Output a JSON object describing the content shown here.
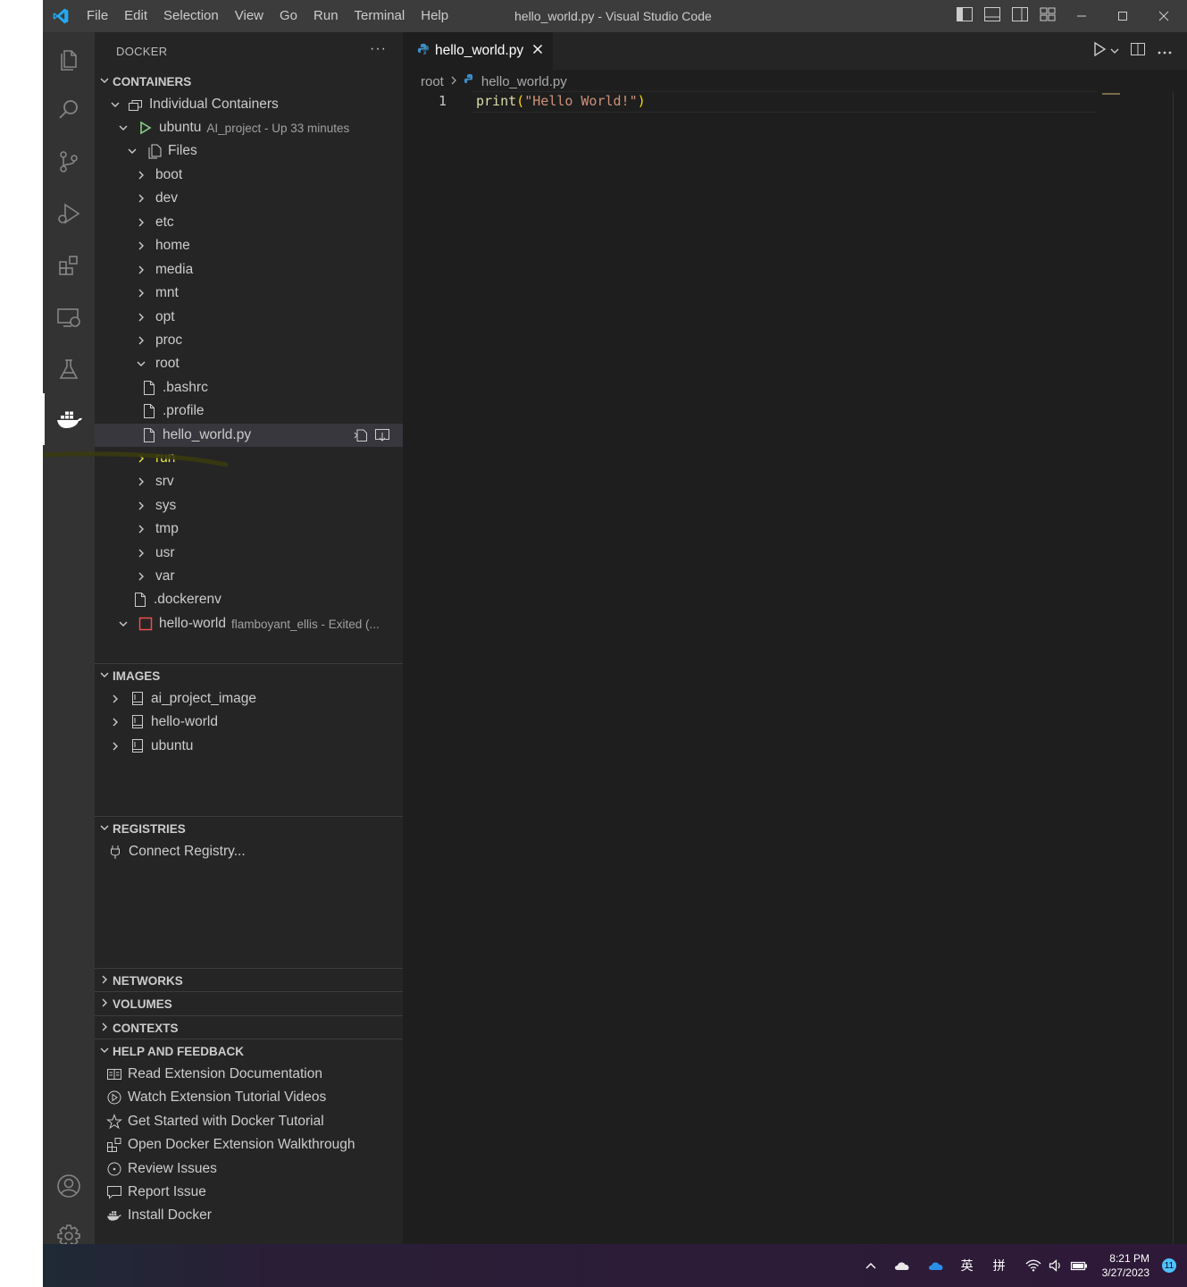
{
  "titlebar": {
    "menu": [
      "File",
      "Edit",
      "Selection",
      "View",
      "Go",
      "Run",
      "Terminal",
      "Help"
    ],
    "title": "hello_world.py - Visual Studio Code"
  },
  "activity": {
    "items": [
      "explorer-icon",
      "search-icon",
      "source-control-icon",
      "run-debug-icon",
      "extensions-icon",
      "remote-explorer-icon",
      "testing-icon",
      "docker-icon",
      "accounts-icon",
      "settings-gear-icon"
    ]
  },
  "sidebar": {
    "title": "DOCKER",
    "more": "···",
    "containers": {
      "header": "CONTAINERS",
      "group": "Individual Containers",
      "ubuntu": {
        "name": "ubuntu",
        "desc": "AI_project - Up 33 minutes"
      },
      "files": "Files",
      "folders": [
        "boot",
        "dev",
        "etc",
        "home",
        "media",
        "mnt",
        "opt",
        "proc"
      ],
      "root": "root",
      "root_files": [
        ".bashrc",
        ".profile",
        "hello_world.py"
      ],
      "folders_after": [
        "run",
        "srv",
        "sys",
        "tmp",
        "usr",
        "var"
      ],
      "dockerenv": ".dockerenv",
      "hello_world": {
        "name": "hello-world",
        "desc": "flamboyant_ellis - Exited (..."
      }
    },
    "images": {
      "header": "IMAGES",
      "items": [
        "ai_project_image",
        "hello-world",
        "ubuntu"
      ]
    },
    "registries": {
      "header": "REGISTRIES",
      "connect": "Connect Registry..."
    },
    "networks": "NETWORKS",
    "volumes": "VOLUMES",
    "contexts": "CONTEXTS",
    "help": {
      "header": "HELP AND FEEDBACK",
      "items": [
        "Read Extension Documentation",
        "Watch Extension Tutorial Videos",
        "Get Started with Docker Tutorial",
        "Open Docker Extension Walkthrough",
        "Review Issues",
        "Report Issue",
        "Install Docker"
      ]
    }
  },
  "editor": {
    "tab": "hello_world.py",
    "breadcrumb": {
      "root": "root",
      "file": "hello_world.py"
    },
    "line_number": "1",
    "code": {
      "fn": "print",
      "open": "(",
      "str": "\"Hello World!\"",
      "close": ")"
    }
  },
  "taskbar": {
    "ime1": "英",
    "ime2": "拼",
    "time": "8:21 PM",
    "date": "3/27/2023",
    "badge": "11"
  },
  "colors": {
    "accent_blue": "#23a9f2",
    "run_highlight": "#e8e83c",
    "container_running": "#89d185",
    "container_exited": "#f14c4c"
  }
}
